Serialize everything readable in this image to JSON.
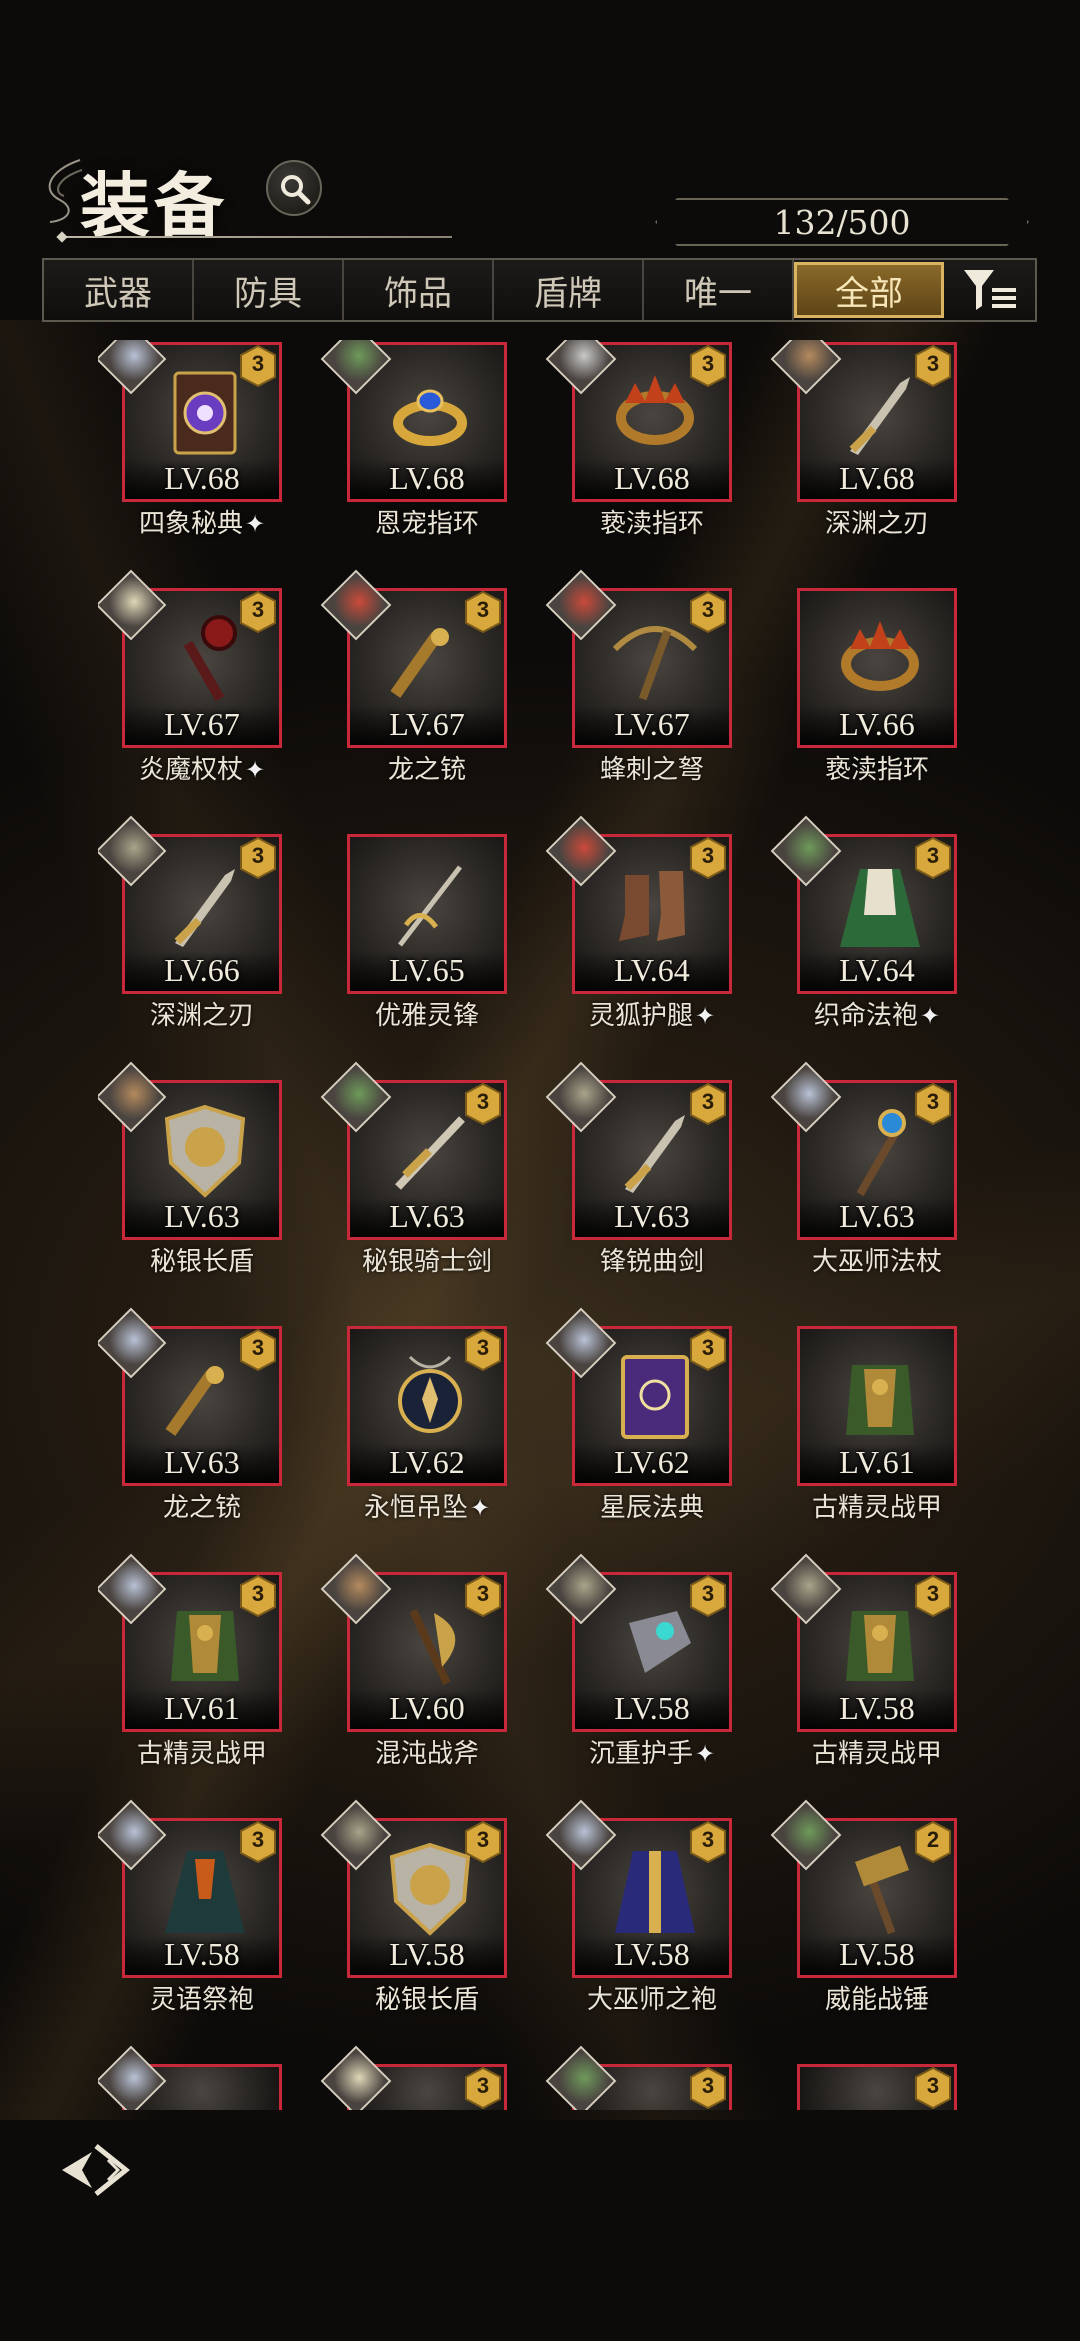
{
  "header": {
    "title": "装备",
    "count": "132/500"
  },
  "tabs": [
    {
      "label": "武器",
      "active": false
    },
    {
      "label": "防具",
      "active": false
    },
    {
      "label": "饰品",
      "active": false
    },
    {
      "label": "盾牌",
      "active": false
    },
    {
      "label": "唯一",
      "active": false
    },
    {
      "label": "全部",
      "active": true
    }
  ],
  "items": [
    {
      "level": "LV.68",
      "name": "四象秘典",
      "star": true,
      "rank": "3",
      "art": "tome",
      "portrait": "#b9c2d6"
    },
    {
      "level": "LV.68",
      "name": "恩宠指环",
      "star": false,
      "rank": "",
      "art": "ring-blue",
      "portrait": "#6e9a5a"
    },
    {
      "level": "LV.68",
      "name": "亵渎指环",
      "star": false,
      "rank": "3",
      "art": "ring-fire",
      "portrait": "#c9c9c9"
    },
    {
      "level": "LV.68",
      "name": "深渊之刃",
      "star": false,
      "rank": "3",
      "art": "blade",
      "portrait": "#b48a5e"
    },
    {
      "level": "LV.67",
      "name": "炎魔权杖",
      "star": true,
      "rank": "3",
      "art": "scepter",
      "portrait": "#e0d6b8"
    },
    {
      "level": "LV.67",
      "name": "龙之铳",
      "star": false,
      "rank": "3",
      "art": "gun",
      "portrait": "#c94a3a"
    },
    {
      "level": "LV.67",
      "name": "蜂刺之弩",
      "star": false,
      "rank": "3",
      "art": "crossbow",
      "portrait": "#c94a3a"
    },
    {
      "level": "LV.66",
      "name": "亵渎指环",
      "star": false,
      "rank": "",
      "art": "ring-fire",
      "portrait": ""
    },
    {
      "level": "LV.66",
      "name": "深渊之刃",
      "star": false,
      "rank": "3",
      "art": "blade",
      "portrait": "#a9a48a"
    },
    {
      "level": "LV.65",
      "name": "优雅灵锋",
      "star": false,
      "rank": "",
      "art": "rapier",
      "portrait": ""
    },
    {
      "level": "LV.64",
      "name": "灵狐护腿",
      "star": true,
      "rank": "3",
      "art": "boots",
      "portrait": "#c94a3a"
    },
    {
      "level": "LV.64",
      "name": "织命法袍",
      "star": true,
      "rank": "3",
      "art": "cloak-green",
      "portrait": "#6e9a5a"
    },
    {
      "level": "LV.63",
      "name": "秘银长盾",
      "star": false,
      "rank": "",
      "art": "shield",
      "portrait": "#b48a5e"
    },
    {
      "level": "LV.63",
      "name": "秘银骑士剑",
      "star": false,
      "rank": "3",
      "art": "sword",
      "portrait": "#6e9a5a"
    },
    {
      "level": "LV.63",
      "name": "锋锐曲剑",
      "star": false,
      "rank": "3",
      "art": "blade",
      "portrait": "#a9a48a"
    },
    {
      "level": "LV.63",
      "name": "大巫师法杖",
      "star": false,
      "rank": "3",
      "art": "staff",
      "portrait": "#b9c2d6"
    },
    {
      "level": "LV.63",
      "name": "龙之铳",
      "star": false,
      "rank": "3",
      "art": "gun",
      "portrait": "#b9c2d6"
    },
    {
      "level": "LV.62",
      "name": "永恒吊坠",
      "star": true,
      "rank": "3",
      "art": "pendant",
      "portrait": ""
    },
    {
      "level": "LV.62",
      "name": "星辰法典",
      "star": false,
      "rank": "3",
      "art": "tome-purple",
      "portrait": "#b9c2d6"
    },
    {
      "level": "LV.61",
      "name": "古精灵战甲",
      "star": false,
      "rank": "",
      "art": "armor",
      "portrait": ""
    },
    {
      "level": "LV.61",
      "name": "古精灵战甲",
      "star": false,
      "rank": "3",
      "art": "armor",
      "portrait": "#b9c2d6"
    },
    {
      "level": "LV.60",
      "name": "混沌战斧",
      "star": false,
      "rank": "3",
      "art": "axe",
      "portrait": "#b48a5e"
    },
    {
      "level": "LV.58",
      "name": "沉重护手",
      "star": true,
      "rank": "3",
      "art": "gauntlet",
      "portrait": "#a9a48a"
    },
    {
      "level": "LV.58",
      "name": "古精灵战甲",
      "star": false,
      "rank": "3",
      "art": "armor",
      "portrait": "#a9a48a"
    },
    {
      "level": "LV.58",
      "name": "灵语祭袍",
      "star": false,
      "rank": "3",
      "art": "robe-dark",
      "portrait": "#b9c2d6"
    },
    {
      "level": "LV.58",
      "name": "秘银长盾",
      "star": false,
      "rank": "3",
      "art": "shield",
      "portrait": "#a9a48a"
    },
    {
      "level": "LV.58",
      "name": "大巫师之袍",
      "star": false,
      "rank": "3",
      "art": "robe-blue",
      "portrait": "#b9c2d6"
    },
    {
      "level": "LV.58",
      "name": "威能战锤",
      "star": false,
      "rank": "2",
      "art": "hammer",
      "portrait": "#6e9a5a"
    }
  ],
  "partial_items": [
    {
      "rank": "",
      "portrait": "#b9c2d6"
    },
    {
      "rank": "3",
      "portrait": "#e0d6b8"
    },
    {
      "rank": "3",
      "portrait": "#6e9a5a"
    },
    {
      "rank": "3",
      "portrait": ""
    }
  ],
  "colors": {
    "frame": "#c8283a",
    "badge": "#d8a83c",
    "tab_active": "#d9b360"
  }
}
